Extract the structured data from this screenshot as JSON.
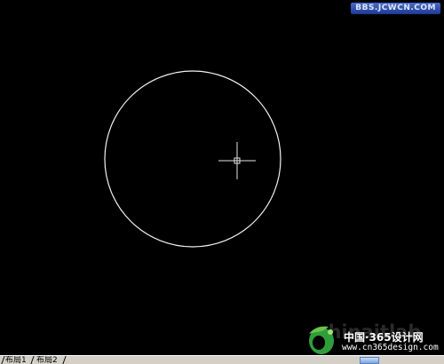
{
  "watermark": {
    "site_mark": "BBS.JCWCN.COM",
    "logo_ghost": "chinaitlab",
    "logo_title": "中国·365设计网",
    "logo_domain": "www.cn365design.com"
  },
  "canvas": {
    "background": "#000000",
    "stroke_color": "#ffffff",
    "objects": [
      {
        "type": "circle",
        "name": "drawn-circle"
      }
    ],
    "cursor": {
      "type": "crosshair-pickbox"
    }
  },
  "layout_tabs": [
    {
      "label": "布局1"
    },
    {
      "label": "布局2"
    }
  ],
  "colors": {
    "tab_bar": "#d4d0c8",
    "site_mark_bg": "#2d4aa8",
    "logo_green": "#2f9e3a"
  }
}
